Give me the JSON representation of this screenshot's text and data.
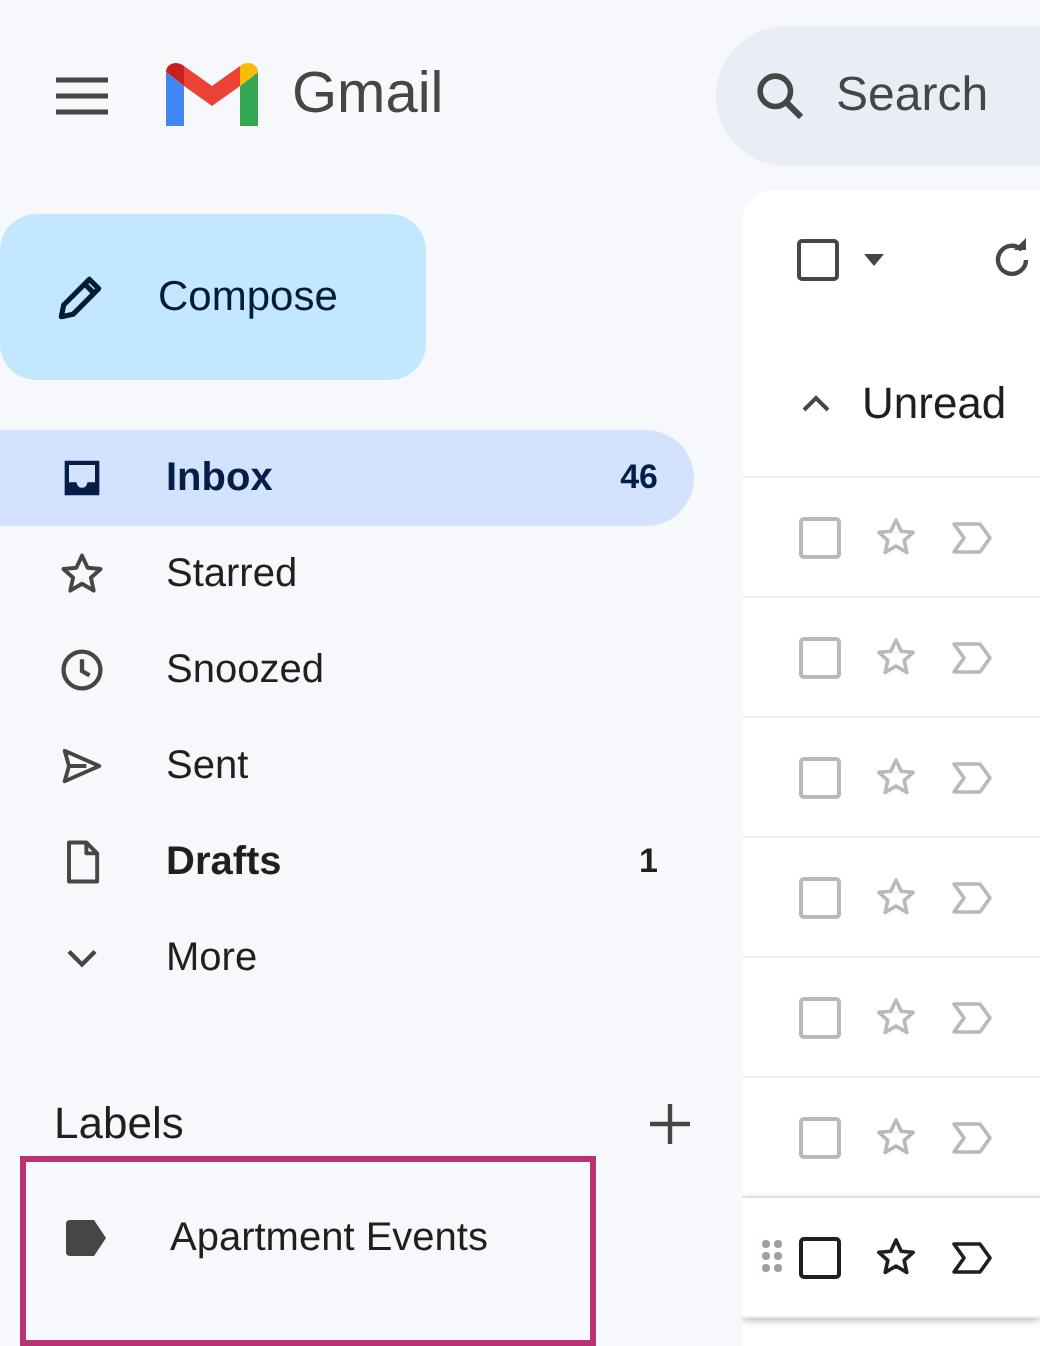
{
  "app": {
    "name": "Gmail"
  },
  "search": {
    "placeholder": "Search"
  },
  "compose": {
    "label": "Compose"
  },
  "nav": [
    {
      "label": "Inbox",
      "count": "46",
      "selected": true,
      "unread": true
    },
    {
      "label": "Starred",
      "selected": false,
      "unread": false
    },
    {
      "label": "Snoozed",
      "selected": false,
      "unread": false
    },
    {
      "label": "Sent",
      "selected": false,
      "unread": false
    },
    {
      "label": "Drafts",
      "count": "1",
      "selected": false,
      "unread": true
    },
    {
      "label": "More",
      "selected": false,
      "unread": false
    }
  ],
  "labels": {
    "title": "Labels",
    "items": [
      {
        "label": "Apartment Events",
        "highlighted": true
      }
    ]
  },
  "toolbar": {
    "select_all_checked": false
  },
  "section": {
    "title": "Unread",
    "expanded": true
  },
  "rows": [
    {
      "checked": false,
      "starred": false,
      "hovered": false
    },
    {
      "checked": false,
      "starred": false,
      "hovered": false
    },
    {
      "checked": false,
      "starred": false,
      "hovered": false
    },
    {
      "checked": false,
      "starred": false,
      "hovered": false
    },
    {
      "checked": false,
      "starred": false,
      "hovered": false
    },
    {
      "checked": false,
      "starred": false,
      "hovered": false
    },
    {
      "checked": false,
      "starred": false,
      "hovered": true
    }
  ]
}
